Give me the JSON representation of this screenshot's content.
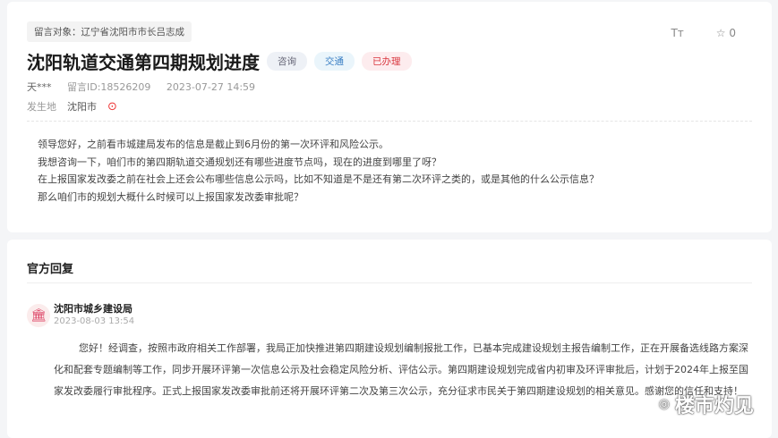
{
  "message": {
    "target": "留言对象：辽宁省沈阳市市长吕志成",
    "title": "沈阳轨道交通第四期规划进度",
    "tags": [
      {
        "label": "咨询",
        "bg": "#eef1f6",
        "color": "#667"
      },
      {
        "label": "交通",
        "bg": "#eaf5fb",
        "color": "#3a7fc4"
      },
      {
        "label": "已办理",
        "bg": "#fdecee",
        "color": "#d9363e"
      }
    ],
    "user": "天***",
    "id": "留言ID:18526209",
    "time": "2023-07-27 14:59",
    "place_label": "发生地",
    "place": "沈阳市",
    "body": [
      "领导您好，之前看市城建局发布的信息是截止到6月份的第一次环评和风险公示。",
      "我想咨询一下，咱们市的第四期轨道交通规划还有哪些进度节点吗，现在的进度到哪里了呀？",
      "在上报国家发改委之前在社会上还会公布哪些信息公示吗，比如不知道是不是还有第二次环评之类的，或是其他的什么公示信息？",
      "那么咱们市的规划大概什么时候可以上报国家发改委审批呢？"
    ],
    "font_size_label": "Tт",
    "favorites": "0"
  },
  "reply": {
    "heading": "官方回复",
    "org": "沈阳市城乡建设局",
    "time": "2023-08-03 13:54",
    "text": "您好！经调查，按照市政府相关工作部署，我局正加快推进第四期建设规划编制报批工作，已基本完成建设规划主报告编制工作，正在开展备选线路方案深化和配套专题编制等工作，同步开展环评第一次信息公示及社会稳定风险分析、评估公示。第四期建设规划完成省内初审及环评审批后，计划于2024年上报至国家发改委履行审批程序。正式上报国家发改委审批前还将开展环评第二次及第三次公示，充分征求市民关于第四期建设规划的相关意见。感谢您的信任和支持！"
  },
  "watermark": "楼市灼见"
}
